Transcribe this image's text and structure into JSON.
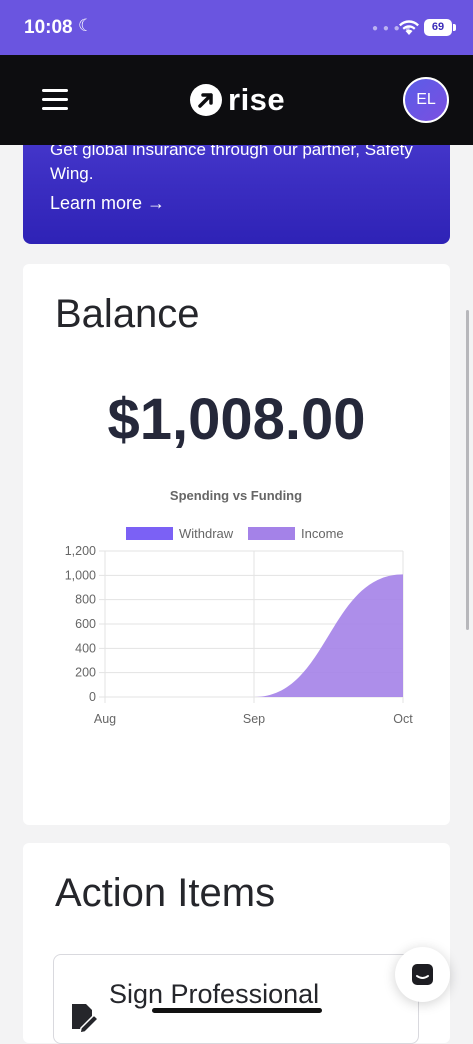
{
  "status": {
    "time": "10:08",
    "battery": "69"
  },
  "nav": {
    "logo": "rise",
    "avatar": "EL"
  },
  "promo": {
    "text": "Get global insurance through our partner, Safety Wing.",
    "link": "Learn more →"
  },
  "balance": {
    "title": "Balance",
    "amount": "$1,008.00"
  },
  "chart_data": {
    "type": "area",
    "title": "Spending vs Funding",
    "legend": [
      "Withdraw",
      "Income"
    ],
    "legend_position": "top",
    "categories": [
      "Aug",
      "Sep",
      "Oct"
    ],
    "series": [
      {
        "name": "Withdraw",
        "values": [
          0,
          0,
          0
        ],
        "color": "#7b61f5"
      },
      {
        "name": "Income",
        "values": [
          0,
          0,
          1008
        ],
        "color": "#a482e8"
      }
    ],
    "yticks": [
      1200,
      1000,
      800,
      600,
      400,
      200,
      0
    ],
    "ylim": [
      0,
      1200
    ],
    "grid": true
  },
  "actions": {
    "title": "Action Items",
    "items": [
      {
        "label": "Sign Professional"
      }
    ]
  }
}
